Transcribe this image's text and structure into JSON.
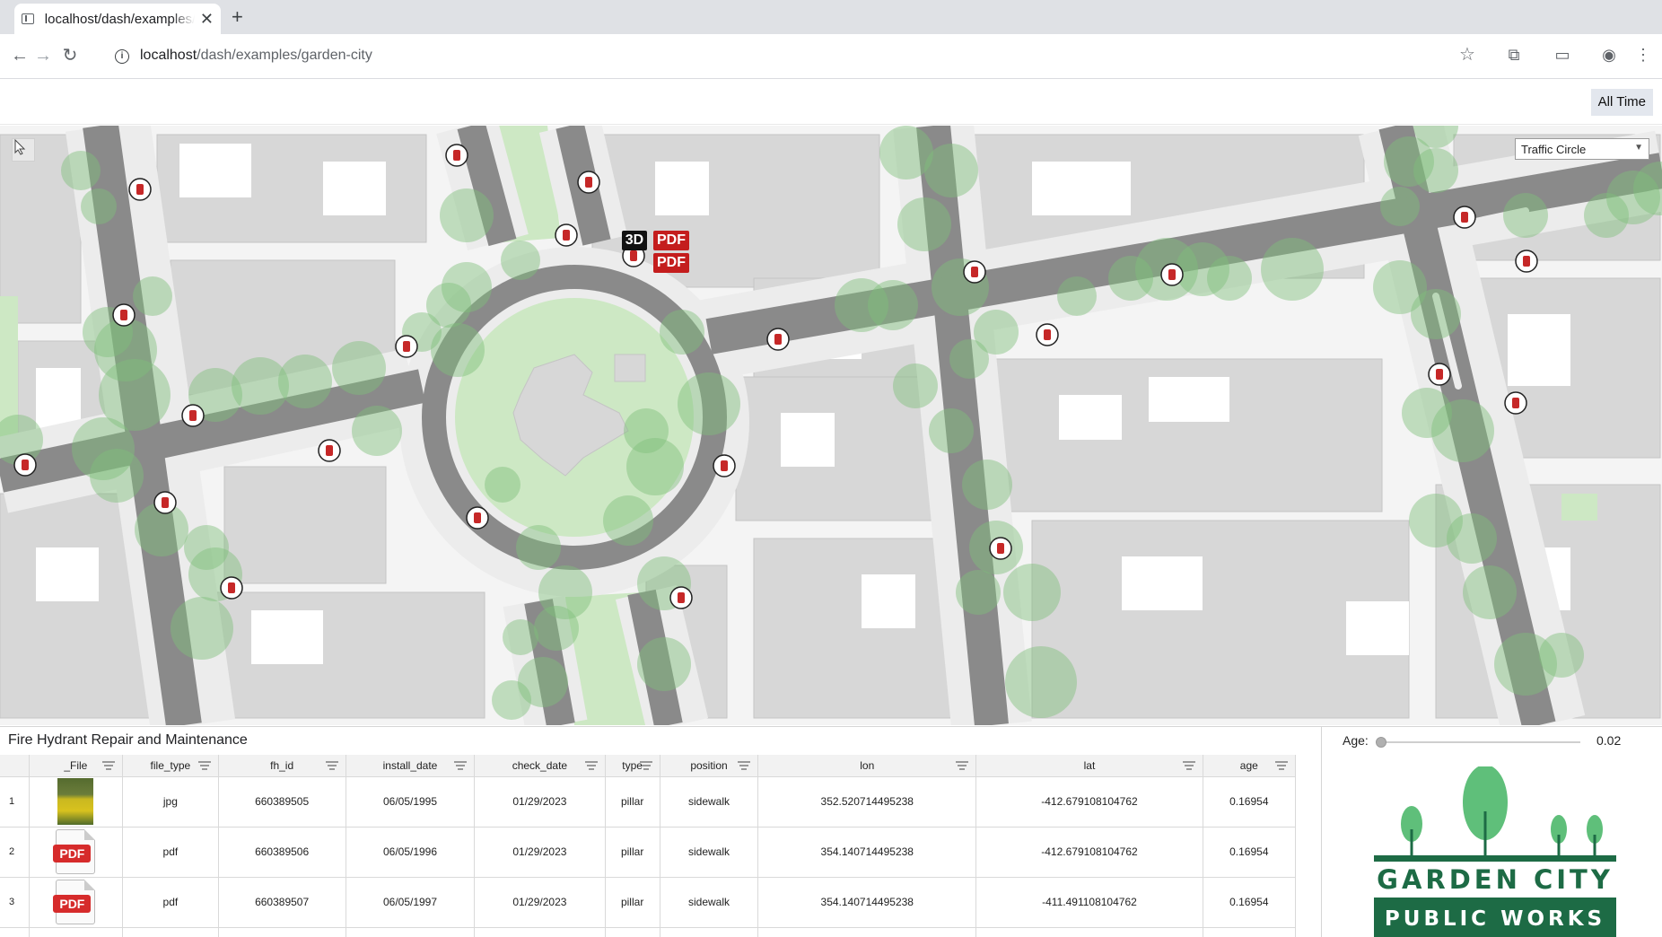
{
  "browser": {
    "tab_title": "localhost/dash/examples/garden-city",
    "url_host": "localhost",
    "url_path": "/dash/examples/garden-city"
  },
  "header": {
    "time_button": "All Time"
  },
  "map": {
    "layer_select": "Traffic Circle",
    "badge_3d": "3D",
    "badge_pdf": "PDF",
    "badge_pdf_2": "PDF"
  },
  "table": {
    "title": "Fire Hydrant Repair and Maintenance",
    "columns": [
      "_File",
      "file_type",
      "fh_id",
      "install_date",
      "check_date",
      "type",
      "position",
      "lon",
      "lat",
      "age"
    ],
    "rows": [
      {
        "index": "1",
        "thumb": "jpg",
        "file_type": "jpg",
        "fh_id": "660389505",
        "install_date": "06/05/1995",
        "check_date": "01/29/2023",
        "type": "pillar",
        "position": "sidewalk",
        "lon": "352.520714495238",
        "lat": "-412.679108104762",
        "age": "0.16954"
      },
      {
        "index": "2",
        "thumb": "pdf",
        "file_type": "pdf",
        "fh_id": "660389506",
        "install_date": "06/05/1996",
        "check_date": "01/29/2023",
        "type": "pillar",
        "position": "sidewalk",
        "lon": "354.140714495238",
        "lat": "-412.679108104762",
        "age": "0.16954"
      },
      {
        "index": "3",
        "thumb": "pdf",
        "file_type": "pdf",
        "fh_id": "660389507",
        "install_date": "06/05/1997",
        "check_date": "01/29/2023",
        "type": "pillar",
        "position": "sidewalk",
        "lon": "354.140714495238",
        "lat": "-411.491108104762",
        "age": "0.16954"
      }
    ],
    "pdf_thumb_label": "PDF"
  },
  "age_filter": {
    "label": "Age:",
    "value": "0.02",
    "slider_fraction": 0.0
  },
  "logo": {
    "line1": "GARDEN CITY",
    "line2": "PUBLIC WORKS",
    "color": "#1d6b45"
  },
  "colors": {
    "road": "#8a8a8a",
    "sidewalk": "#eeeeee",
    "building": "#d7d7d7",
    "park": "#cde8c4",
    "tree": "#7fbf7a",
    "hydrant": "#c62828",
    "pdf_red": "#c41d1d"
  }
}
